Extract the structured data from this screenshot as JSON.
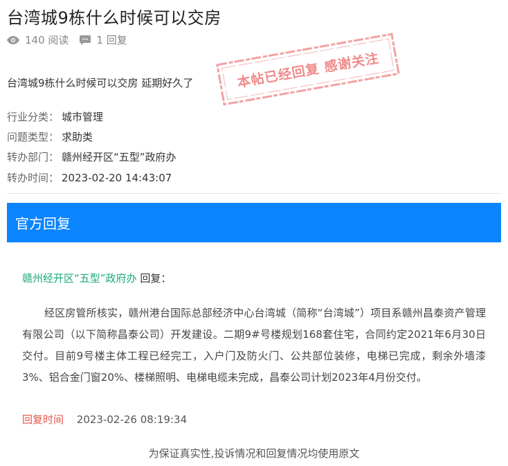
{
  "post": {
    "title": "台湾城9栋什么时候可以交房",
    "views": "140 阅读",
    "replies": "1 回复",
    "body": "台湾城9栋什么时候可以交房 延期好久了",
    "stamp": "本帖已经回复 感谢关注"
  },
  "info": [
    {
      "label": "行业分类：",
      "value": "城市管理"
    },
    {
      "label": "问题类型：",
      "value": "求助类"
    },
    {
      "label": "转办部门：",
      "value": "赣州经开区“五型”政府办"
    },
    {
      "label": "转办时间：",
      "value": "2023-02-20 14:43:07"
    }
  ],
  "reply": {
    "header": "官方回复",
    "department": "赣州经开区“五型”政府办",
    "dept_suffix": "回复：",
    "content": "经区房管所核实，赣州港台国际总部经济中心台湾城（简称“台湾城”）项目系赣州昌泰资产管理有限公司（以下简称昌泰公司）开发建设。二期9#号楼规划168套住宅，合同约定2021年6月30日交付。目前9号楼主体工程已经完工，入户门及防火门、公共部位装修，电梯已完成，剩余外墙漆3%、铝合金门窗20%、楼梯照明、电梯电缆未完成，昌泰公司计划2023年4月份交付。",
    "time_label": "回复时间",
    "time_value": "2023-02-26 08:19:34"
  },
  "footer": "为保证真实性,投诉情况和回复情况均使用原文",
  "colors": {
    "accent": "#0a84ff",
    "dept": "#1aa97b",
    "time_label": "#e2574c",
    "stamp": "#f08a8a"
  },
  "icons": {
    "views": "eye-icon",
    "replies": "comment-icon"
  }
}
